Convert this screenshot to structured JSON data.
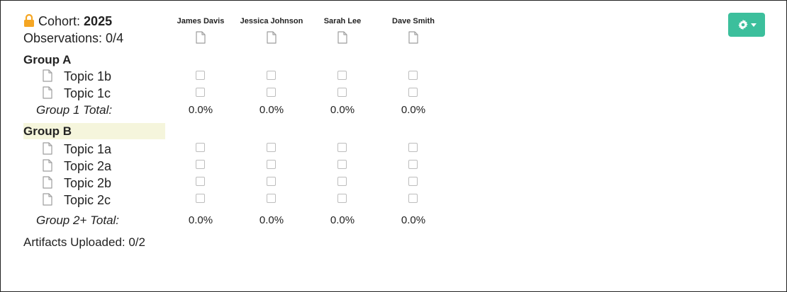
{
  "header": {
    "cohort_label": "Cohort:",
    "cohort_year": "2025",
    "observations_label": "Observations: 0/4"
  },
  "students": [
    {
      "name": "James Davis"
    },
    {
      "name": "Jessica Johnson"
    },
    {
      "name": "Sarah Lee"
    },
    {
      "name": "Dave Smith"
    }
  ],
  "groups": [
    {
      "title": "Group A",
      "topics": [
        {
          "label": "Topic 1b"
        },
        {
          "label": "Topic 1c"
        }
      ],
      "total_label": "Group 1 Total:",
      "totals": [
        "0.0%",
        "0.0%",
        "0.0%",
        "0.0%"
      ]
    },
    {
      "title": "Group B",
      "topics": [
        {
          "label": "Topic 1a"
        },
        {
          "label": "Topic 2a"
        },
        {
          "label": "Topic 2b"
        },
        {
          "label": "Topic 2c"
        }
      ],
      "total_label": "Group 2+ Total:",
      "totals": [
        "0.0%",
        "0.0%",
        "0.0%",
        "0.0%"
      ]
    }
  ],
  "footer": {
    "artifacts_label": "Artifacts Uploaded: 0/2"
  },
  "colors": {
    "accent": "#3cbf9c",
    "lock": "#f5a623",
    "group_highlight": "#f5f5dc"
  },
  "icons": {
    "lock": "lock-icon",
    "document": "document-icon",
    "gear": "gear-icon",
    "caret": "caret-down-icon"
  }
}
